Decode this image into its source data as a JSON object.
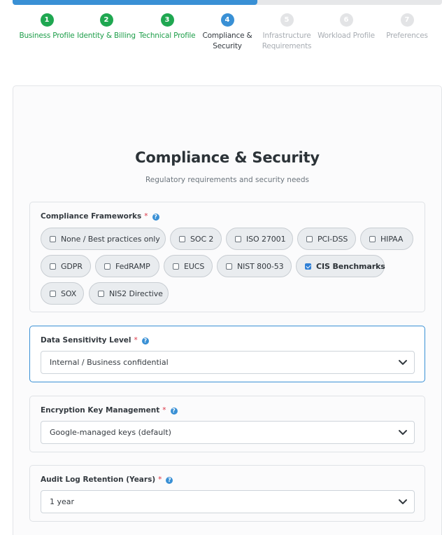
{
  "progress": {
    "fraction": 0.57,
    "color": "#3990d5"
  },
  "steps": [
    {
      "num": "1",
      "label": "Business Profile",
      "state": "done"
    },
    {
      "num": "2",
      "label": "Identity & Billing",
      "state": "done"
    },
    {
      "num": "3",
      "label": "Technical Profile",
      "state": "done"
    },
    {
      "num": "4",
      "label": "Compliance & Security",
      "state": "active"
    },
    {
      "num": "5",
      "label": "Infrastructure Requirements",
      "state": "todo"
    },
    {
      "num": "6",
      "label": "Workload Profile",
      "state": "todo"
    },
    {
      "num": "7",
      "label": "Preferences",
      "state": "todo"
    }
  ],
  "page": {
    "title": "Compliance & Security",
    "subtitle": "Regulatory requirements and security needs"
  },
  "required_mark": "*",
  "help_glyph": "?",
  "frameworks": {
    "label": "Compliance Frameworks",
    "options": [
      {
        "label": "None / Best practices only",
        "checked": false
      },
      {
        "label": "SOC 2",
        "checked": false
      },
      {
        "label": "ISO 27001",
        "checked": false
      },
      {
        "label": "PCI-DSS",
        "checked": false
      },
      {
        "label": "HIPAA",
        "checked": false
      },
      {
        "label": "GDPR",
        "checked": false
      },
      {
        "label": "FedRAMP",
        "checked": false
      },
      {
        "label": "EUCS",
        "checked": false
      },
      {
        "label": "NIST 800-53",
        "checked": false
      },
      {
        "label": "CIS Benchmarks",
        "checked": true
      },
      {
        "label": "SOX",
        "checked": false
      },
      {
        "label": "NIS2 Directive",
        "checked": false
      }
    ]
  },
  "sensitivity": {
    "label": "Data Sensitivity Level",
    "value": "Internal / Business confidential"
  },
  "encryption": {
    "label": "Encryption Key Management",
    "value": "Google-managed keys (default)"
  },
  "audit": {
    "label": "Audit Log Retention (Years)",
    "value": "1 year"
  },
  "colors": {
    "done": "#1fa751",
    "active": "#3990d5",
    "pending": "#e3e4e6",
    "required": "#dc3545",
    "accent": "#3990d5"
  }
}
